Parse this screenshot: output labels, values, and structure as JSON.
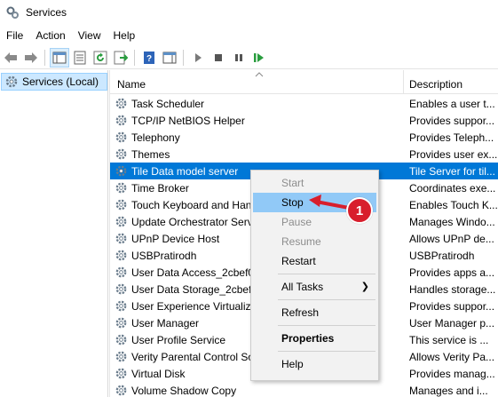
{
  "window": {
    "title": "Services"
  },
  "menubar": {
    "items": [
      "File",
      "Action",
      "View",
      "Help"
    ]
  },
  "left_pane": {
    "tree_item": "Services (Local)"
  },
  "table": {
    "columns": {
      "name": "Name",
      "description": "Description"
    },
    "rows": [
      {
        "name": "Task Scheduler",
        "description": "Enables a user t..."
      },
      {
        "name": "TCP/IP NetBIOS Helper",
        "description": "Provides suppor..."
      },
      {
        "name": "Telephony",
        "description": "Provides Teleph..."
      },
      {
        "name": "Themes",
        "description": "Provides user ex..."
      },
      {
        "name": "Tile Data model server",
        "description": "Tile Server for til..."
      },
      {
        "name": "Time Broker",
        "description": "Coordinates exe..."
      },
      {
        "name": "Touch Keyboard and Han",
        "description": "Enables Touch K..."
      },
      {
        "name": "Update Orchestrator Servi",
        "description": "Manages Windo..."
      },
      {
        "name": "UPnP Device Host",
        "description": "Allows UPnP de..."
      },
      {
        "name": "USBPratirodh",
        "description": "USBPratirodh"
      },
      {
        "name": "User Data Access_2cbef0e",
        "description": "Provides apps a..."
      },
      {
        "name": "User Data Storage_2cbef0",
        "description": "Handles storage..."
      },
      {
        "name": "User Experience Virtualiz",
        "description": "Provides suppor..."
      },
      {
        "name": "User Manager",
        "description": "User Manager p..."
      },
      {
        "name": "User Profile Service",
        "description": "This service is ..."
      },
      {
        "name": "Verity Parental Control So",
        "description": "Allows Verity Pa..."
      },
      {
        "name": "Virtual Disk",
        "description": "Provides manag..."
      },
      {
        "name": "Volume Shadow Copy",
        "description": "Manages and i..."
      }
    ],
    "selected_row": "Tile Data model server"
  },
  "context_menu": {
    "start": "Start",
    "stop": "Stop",
    "pause": "Pause",
    "resume": "Resume",
    "restart": "Restart",
    "all_tasks": "All Tasks",
    "refresh": "Refresh",
    "properties": "Properties",
    "help": "Help"
  },
  "annotation": {
    "step_number": "1"
  },
  "colors": {
    "selection": "#0078d7",
    "menu_hover": "#91c9f7",
    "badge": "#d81e2c",
    "play_green": "#2a9d3f"
  }
}
